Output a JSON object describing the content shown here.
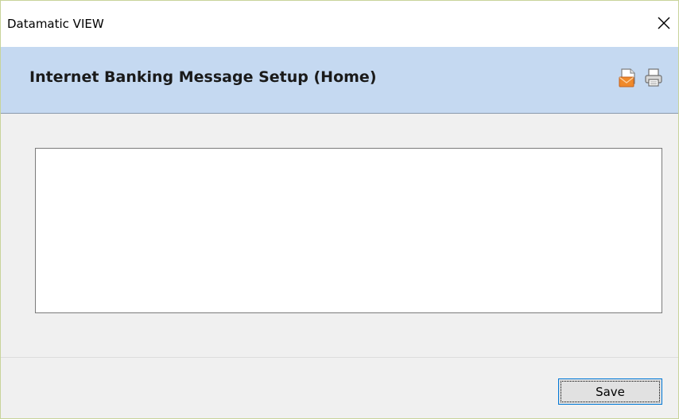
{
  "window": {
    "title": "Datamatic VIEW",
    "close_icon": "close-icon"
  },
  "header": {
    "title": "Internet Banking Message Setup (Home)",
    "background_color": "#c5d9f1",
    "actions": [
      {
        "icon": "email-icon"
      },
      {
        "icon": "print-icon"
      }
    ]
  },
  "message": {
    "value": "",
    "placeholder": ""
  },
  "footer": {
    "save_label": "Save"
  }
}
